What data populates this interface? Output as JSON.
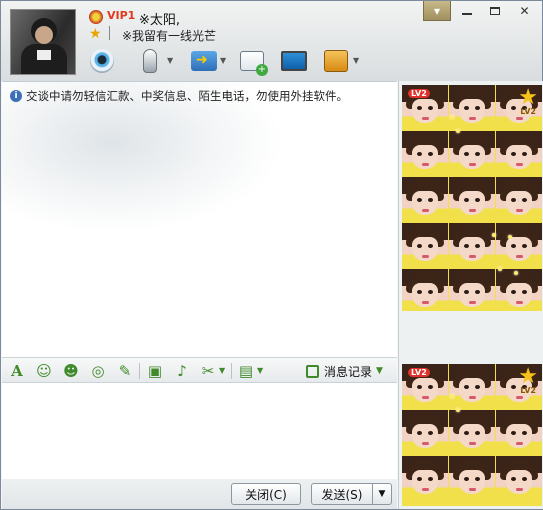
{
  "contact": {
    "vip_label": "VIP1",
    "name": "※太阳,",
    "signature": "※我留有一线光芒"
  },
  "toolbar": {
    "items": [
      {
        "name": "video-call",
        "has_menu": false
      },
      {
        "name": "voice-call",
        "has_menu": true
      },
      {
        "name": "send-file",
        "has_menu": true
      },
      {
        "name": "create-discussion",
        "has_menu": false
      },
      {
        "name": "remote-assistance",
        "has_menu": false
      },
      {
        "name": "apps",
        "has_menu": true
      }
    ]
  },
  "window_controls": [
    "skin",
    "minimize",
    "maximize",
    "close"
  ],
  "chat": {
    "notice": "交谈中请勿轻信汇款、中奖信息、陌生电话，勿使用外挂软件。"
  },
  "format_bar": {
    "tools": [
      "font",
      "emoji",
      "magic-emoji",
      "shake",
      "scribble",
      "image",
      "music",
      "screenshot",
      "toolbox"
    ],
    "history_label": "消息记录"
  },
  "buttons": {
    "close_label": "关闭(C)",
    "send_label": "发送(S)"
  },
  "ads": {
    "badge": "LV2",
    "level": "LV2"
  }
}
